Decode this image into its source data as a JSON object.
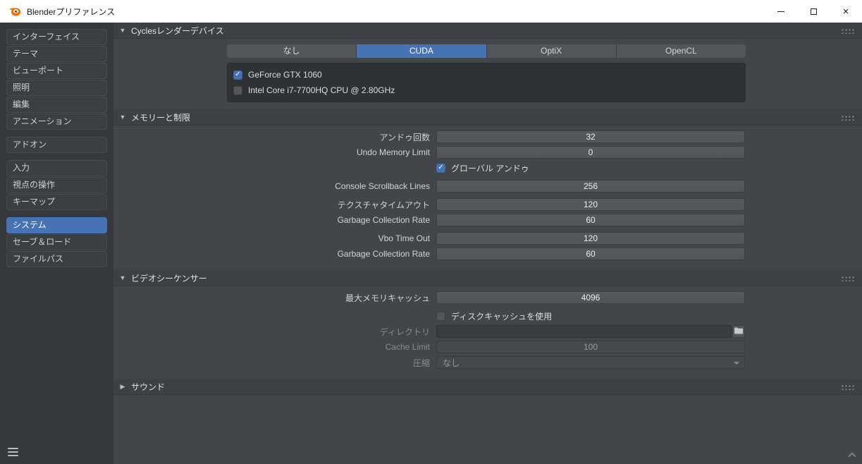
{
  "titlebar": {
    "title": "Blenderプリファレンス"
  },
  "icons": {
    "close": "×",
    "check": "✓",
    "collapse_open": "▼",
    "collapse_closed": "▶"
  },
  "colors": {
    "accent": "#4772b3",
    "titlebar_bg": "#ffffff",
    "content_bg": "#42464a"
  },
  "sidebar": {
    "group1": [
      "インターフェイス",
      "テーマ",
      "ビューポート",
      "照明",
      "編集",
      "アニメーション"
    ],
    "group2": [
      "アドオン"
    ],
    "group3": [
      "入力",
      "視点の操作",
      "キーマップ"
    ],
    "group4": [
      "システム",
      "セーブ＆ロード",
      "ファイルパス"
    ],
    "selected": "システム"
  },
  "cycles": {
    "header": "Cyclesレンダーデバイス",
    "tabs": [
      "なし",
      "CUDA",
      "OptiX",
      "OpenCL"
    ],
    "active_tab": "CUDA",
    "devices": [
      {
        "name": "GeForce GTX 1060",
        "checked": true
      },
      {
        "name": "Intel Core i7-7700HQ CPU @ 2.80GHz",
        "checked": false
      }
    ]
  },
  "memory": {
    "header": "メモリーと制限",
    "undo_steps": {
      "label": "アンドゥ回数",
      "value": "32"
    },
    "undo_memory_limit": {
      "label": "Undo Memory Limit",
      "value": "0"
    },
    "global_undo": {
      "label": "グローバル アンドゥ",
      "checked": true
    },
    "console_scrollback": {
      "label": "Console Scrollback Lines",
      "value": "256"
    },
    "texture_timeout": {
      "label": "テクスチャタイムアウト",
      "value": "120"
    },
    "texture_gc": {
      "label": "Garbage Collection Rate",
      "value": "60"
    },
    "vbo_timeout": {
      "label": "Vbo Time Out",
      "value": "120"
    },
    "vbo_gc": {
      "label": "Garbage Collection Rate",
      "value": "60"
    }
  },
  "sequencer": {
    "header": "ビデオシーケンサー",
    "memory_cache": {
      "label": "最大メモリキャッシュ",
      "value": "4096"
    },
    "use_disk_cache": {
      "label": "ディスクキャッシュを使用",
      "checked": false
    },
    "directory": {
      "label": "ディレクトリ",
      "value": ""
    },
    "cache_limit": {
      "label": "Cache Limit",
      "value": "100"
    },
    "compression": {
      "label": "圧縮",
      "value": "なし"
    }
  },
  "sound": {
    "header": "サウンド"
  }
}
